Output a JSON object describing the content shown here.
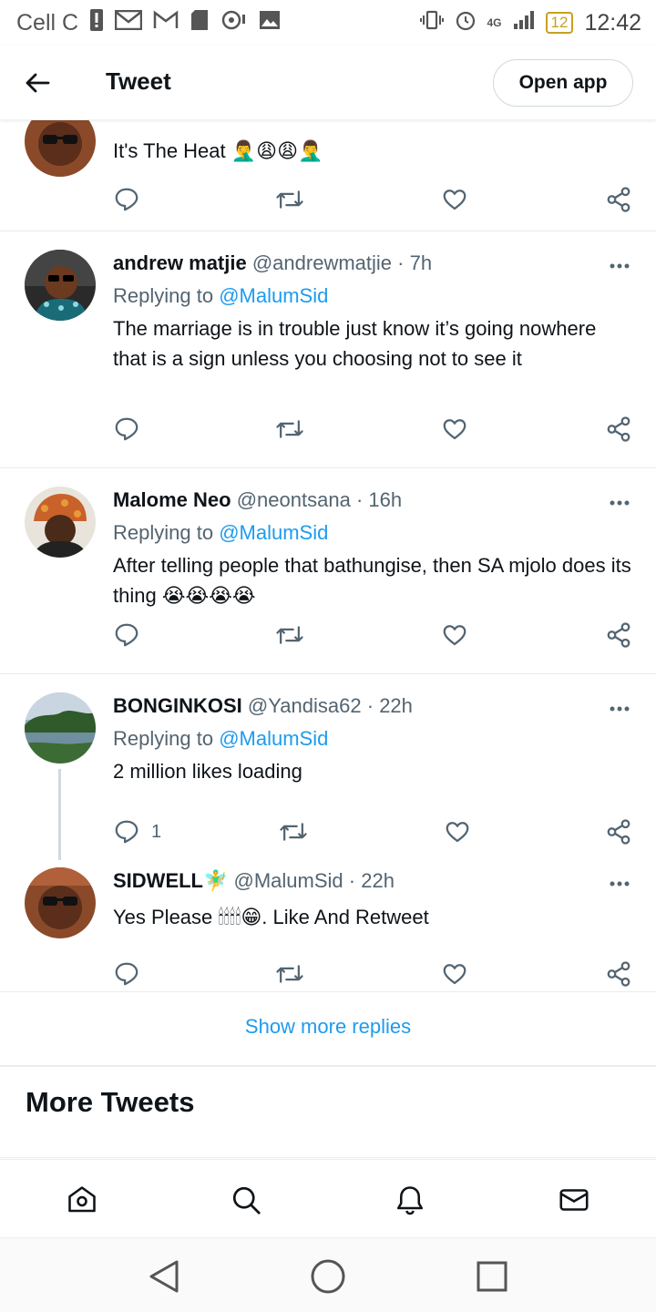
{
  "status_bar": {
    "carrier": "Cell C",
    "network": "4G",
    "battery": "12",
    "time": "12:42"
  },
  "header": {
    "title": "Tweet",
    "open_app": "Open app"
  },
  "tweets": [
    {
      "text": "It's The Heat 🤦‍♂️😩😩🤦‍♂️"
    },
    {
      "name": "andrew matjie",
      "handle": "@andrewmatjie",
      "time": "7h",
      "replying_label": "Replying to",
      "replying_to": "@MalumSid",
      "text": "The marriage is in trouble just know it’s going nowhere that is a sign unless you choosing not to see it"
    },
    {
      "name": "Malome Neo",
      "handle": "@neontsana",
      "time": "16h",
      "replying_label": "Replying to",
      "replying_to": "@MalumSid",
      "text": "After telling people that bathungise, then SA mjolo does its thing 😭😭😭😭"
    },
    {
      "name": "BONGINKOSI",
      "handle": "@Yandisa62",
      "time": "22h",
      "replying_label": "Replying to",
      "replying_to": "@MalumSid",
      "text": "2 million likes loading",
      "reply_count": "1"
    },
    {
      "name": "SIDWELL🧚‍♂️",
      "handle": "@MalumSid",
      "time": "22h",
      "text": "Yes Please 🕯🕯🕯🕯😁. Like And Retweet"
    }
  ],
  "show_more_replies": "Show more replies",
  "more_tweets_title": "More Tweets",
  "icons": {
    "back": "arrow-left-icon",
    "reply": "reply-icon",
    "retweet": "retweet-icon",
    "like": "heart-icon",
    "share": "share-icon",
    "more": "more-icon",
    "home": "home-icon",
    "search": "search-icon",
    "notifications": "bell-icon",
    "messages": "mail-icon"
  },
  "colors": {
    "accent": "#1d9bf0",
    "text": "#0f1419",
    "muted": "#536471"
  }
}
